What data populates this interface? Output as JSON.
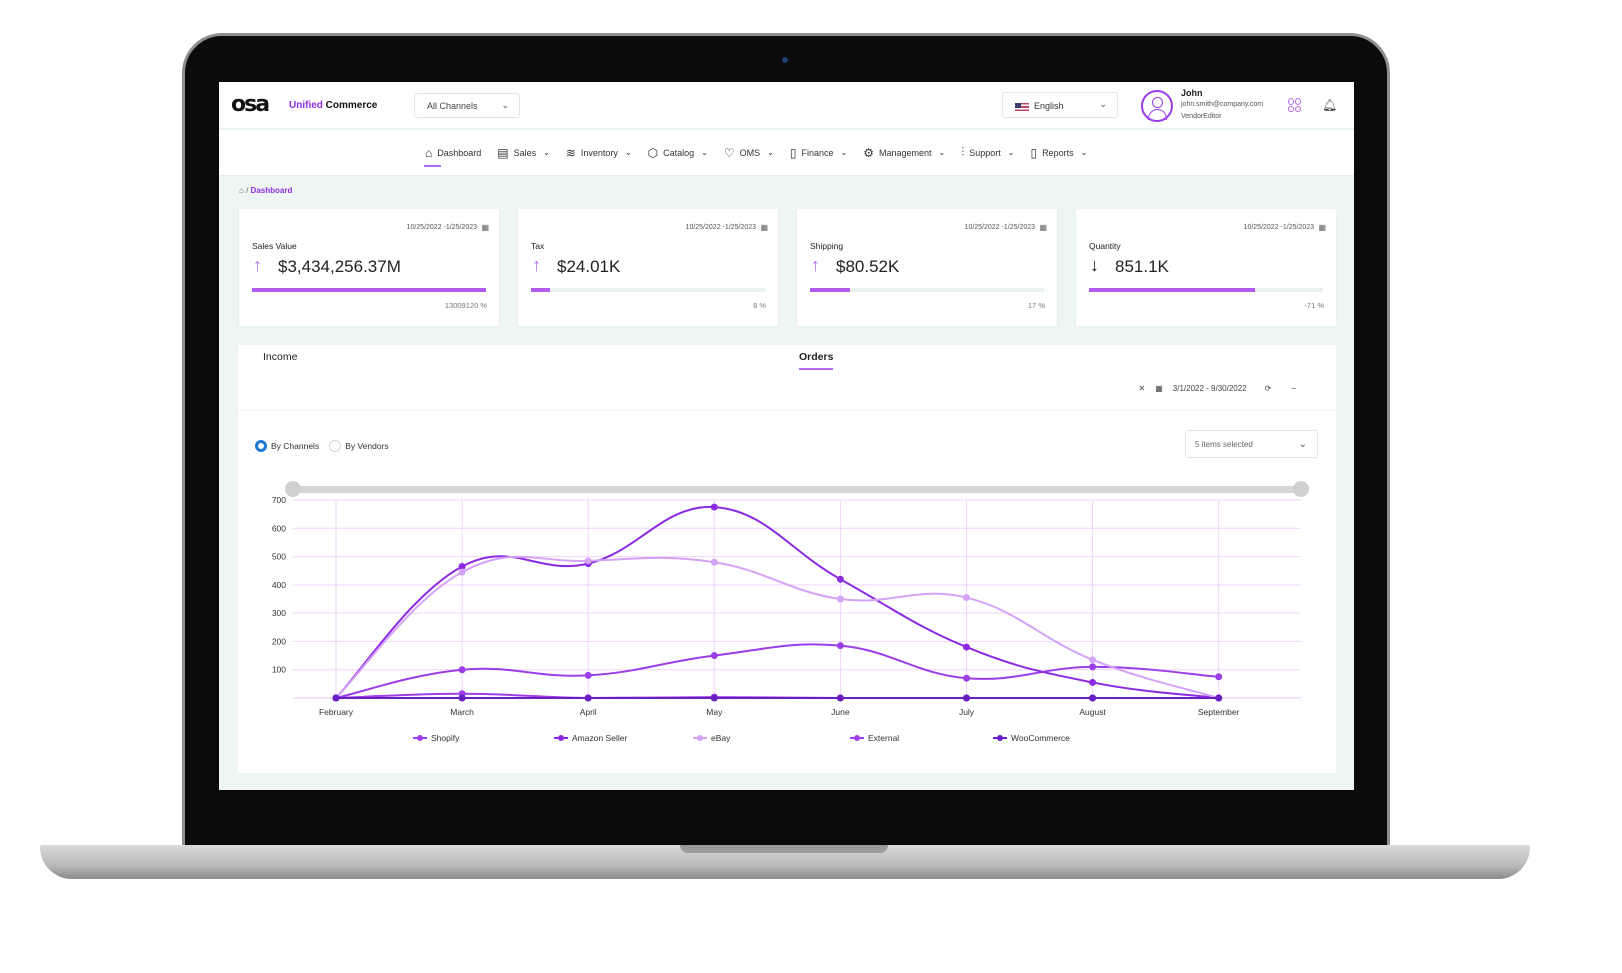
{
  "header": {
    "logo_text": "osa",
    "brand_accent": "Unified",
    "brand_rest": " Commerce",
    "channel_select": "All Channels",
    "language_select": "English",
    "user": {
      "name": "John",
      "email": "john.smith@company.com",
      "role": "VendorEditor"
    }
  },
  "nav": {
    "items": [
      {
        "label": "Dashboard",
        "icon": "home-icon",
        "glyph": "⌂",
        "dropdown": false,
        "active": true
      },
      {
        "label": "Sales",
        "icon": "sales-icon",
        "glyph": "▤",
        "dropdown": true
      },
      {
        "label": "Inventory",
        "icon": "layers-icon",
        "glyph": "≋",
        "dropdown": true
      },
      {
        "label": "Catalog",
        "icon": "box-icon",
        "glyph": "⬡",
        "dropdown": true
      },
      {
        "label": "OMS",
        "icon": "shield-icon",
        "glyph": "♡",
        "dropdown": true
      },
      {
        "label": "Finance",
        "icon": "document-icon",
        "glyph": "▯",
        "dropdown": true
      },
      {
        "label": "Management",
        "icon": "gear-icon",
        "glyph": "⚙",
        "dropdown": true
      },
      {
        "label": "Support",
        "icon": "sliders-icon",
        "glyph": "⫶",
        "dropdown": true
      },
      {
        "label": "Reports",
        "icon": "report-icon",
        "glyph": "▯",
        "dropdown": true
      }
    ]
  },
  "breadcrumb": {
    "sep": "/",
    "current": "Dashboard"
  },
  "kpis": [
    {
      "label": "Sales Value",
      "value": "$3,434,256.37M",
      "trend": "up",
      "date_range": "10/25/2022 -1/25/2023",
      "progress_pct": 100,
      "pct_label": "13009120 %"
    },
    {
      "label": "Tax",
      "value": "$24.01K",
      "trend": "up",
      "date_range": "10/25/2022 -1/25/2023",
      "progress_pct": 8,
      "pct_label": "8 %"
    },
    {
      "label": "Shipping",
      "value": "$80.52K",
      "trend": "up",
      "date_range": "10/25/2022 -1/25/2023",
      "progress_pct": 17,
      "pct_label": "17 %"
    },
    {
      "label": "Quantity",
      "value": "851.1K",
      "trend": "down",
      "date_range": "10/25/2022 -1/25/2023",
      "progress_pct": 71,
      "pct_label": "-71 %"
    }
  ],
  "panel": {
    "tabs": [
      {
        "label": "Income",
        "active": false
      },
      {
        "label": "Orders",
        "active": true
      }
    ],
    "date_range": "3/1/2022 -  9/30/2022",
    "radio": [
      {
        "label": "By Channels",
        "checked": true
      },
      {
        "label": "By Vendors",
        "checked": false
      }
    ],
    "multi_select": "5 items selected"
  },
  "colors": {
    "accent": "#8e2ce0",
    "accent_light": "#b66cf0",
    "radio_blue": "#1d78d6"
  },
  "chart_data": {
    "type": "line",
    "title": "Orders",
    "categories": [
      "February",
      "March",
      "April",
      "May",
      "June",
      "July",
      "August",
      "September"
    ],
    "ylim": [
      0,
      700
    ],
    "yticks": [
      100,
      200,
      300,
      400,
      500,
      600,
      700
    ],
    "grid": true,
    "legend_position": "bottom",
    "series": [
      {
        "name": "Shopify",
        "color": "#9b3ee8",
        "values": [
          0,
          100,
          80,
          150,
          185,
          70,
          110,
          75
        ]
      },
      {
        "name": "Amazon Seller",
        "color": "#8a2be2",
        "values": [
          0,
          465,
          475,
          675,
          420,
          180,
          55,
          0
        ]
      },
      {
        "name": "eBay",
        "color": "#d4a3f7",
        "values": [
          0,
          445,
          485,
          480,
          350,
          355,
          135,
          0
        ]
      },
      {
        "name": "External",
        "color": "#9d3fe6",
        "values": [
          0,
          15,
          0,
          3,
          0,
          0,
          0,
          0
        ]
      },
      {
        "name": "WooCommerce",
        "color": "#6a1fc0",
        "values": [
          0,
          0,
          0,
          0,
          0,
          0,
          0,
          0
        ]
      }
    ]
  }
}
